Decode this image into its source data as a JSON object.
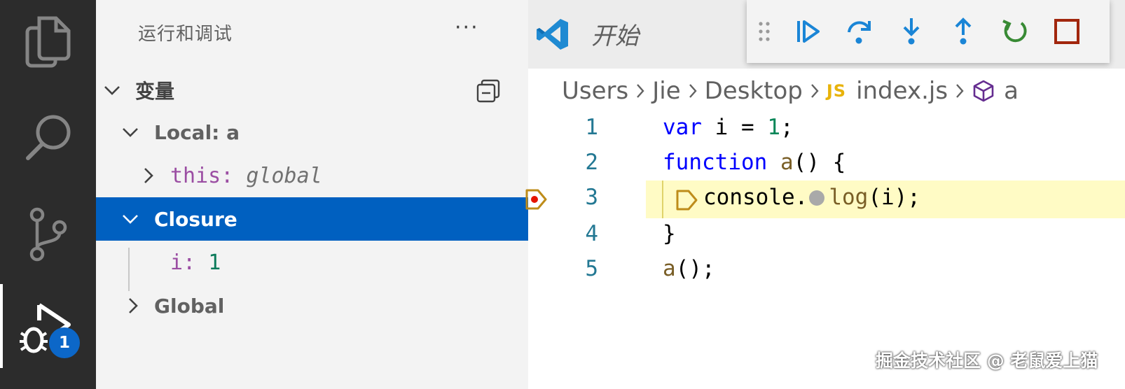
{
  "sidebar": {
    "title": "运行和调试",
    "more_label": "···",
    "sections": {
      "variables_label": "变量",
      "local_label": "Local: a",
      "this_name": "this",
      "this_colon": ":",
      "this_value": "global",
      "closure_label": "Closure",
      "i_name": "i",
      "i_colon": ":",
      "i_value": "1",
      "global_label": "Global"
    }
  },
  "activity_bar": {
    "items": [
      "files-icon",
      "search-icon",
      "source-control-icon",
      "run-debug-icon"
    ],
    "debug_badge": "1",
    "active": "run-debug-icon"
  },
  "editor": {
    "tab_title": "开始",
    "breadcrumbs": {
      "users": "Users",
      "jie": "Jie",
      "desktop": "Desktop",
      "js_badge": "JS",
      "file": "index.js",
      "symbol": "a"
    },
    "debug_toolbar": [
      "drag-handle",
      "continue-icon",
      "step-over-icon",
      "step-into-icon",
      "step-out-icon",
      "restart-icon",
      "stop-icon"
    ],
    "lines": [
      {
        "num": "1",
        "p1": "var",
        "p2": " i = ",
        "p3": "1",
        "p4": ";"
      },
      {
        "num": "2",
        "p1": "function",
        "p2": " ",
        "p3": "a",
        "p4": "() {"
      },
      {
        "num": "3",
        "p1": "console.",
        "p2": "log",
        "p3": "(i);"
      },
      {
        "num": "4",
        "p1": "}"
      },
      {
        "num": "5",
        "p1": "a",
        "p2": "();"
      }
    ],
    "current_line": "3"
  },
  "watermark": "掘金技术社区 @ 老鼠爱上猫",
  "colors": {
    "activity_bg": "#2c2c2c",
    "sidebar_bg": "#f3f3f3",
    "selection": "#0060c0",
    "current_line_bg": "#fffbc5",
    "breakpoint": "#e51400"
  }
}
